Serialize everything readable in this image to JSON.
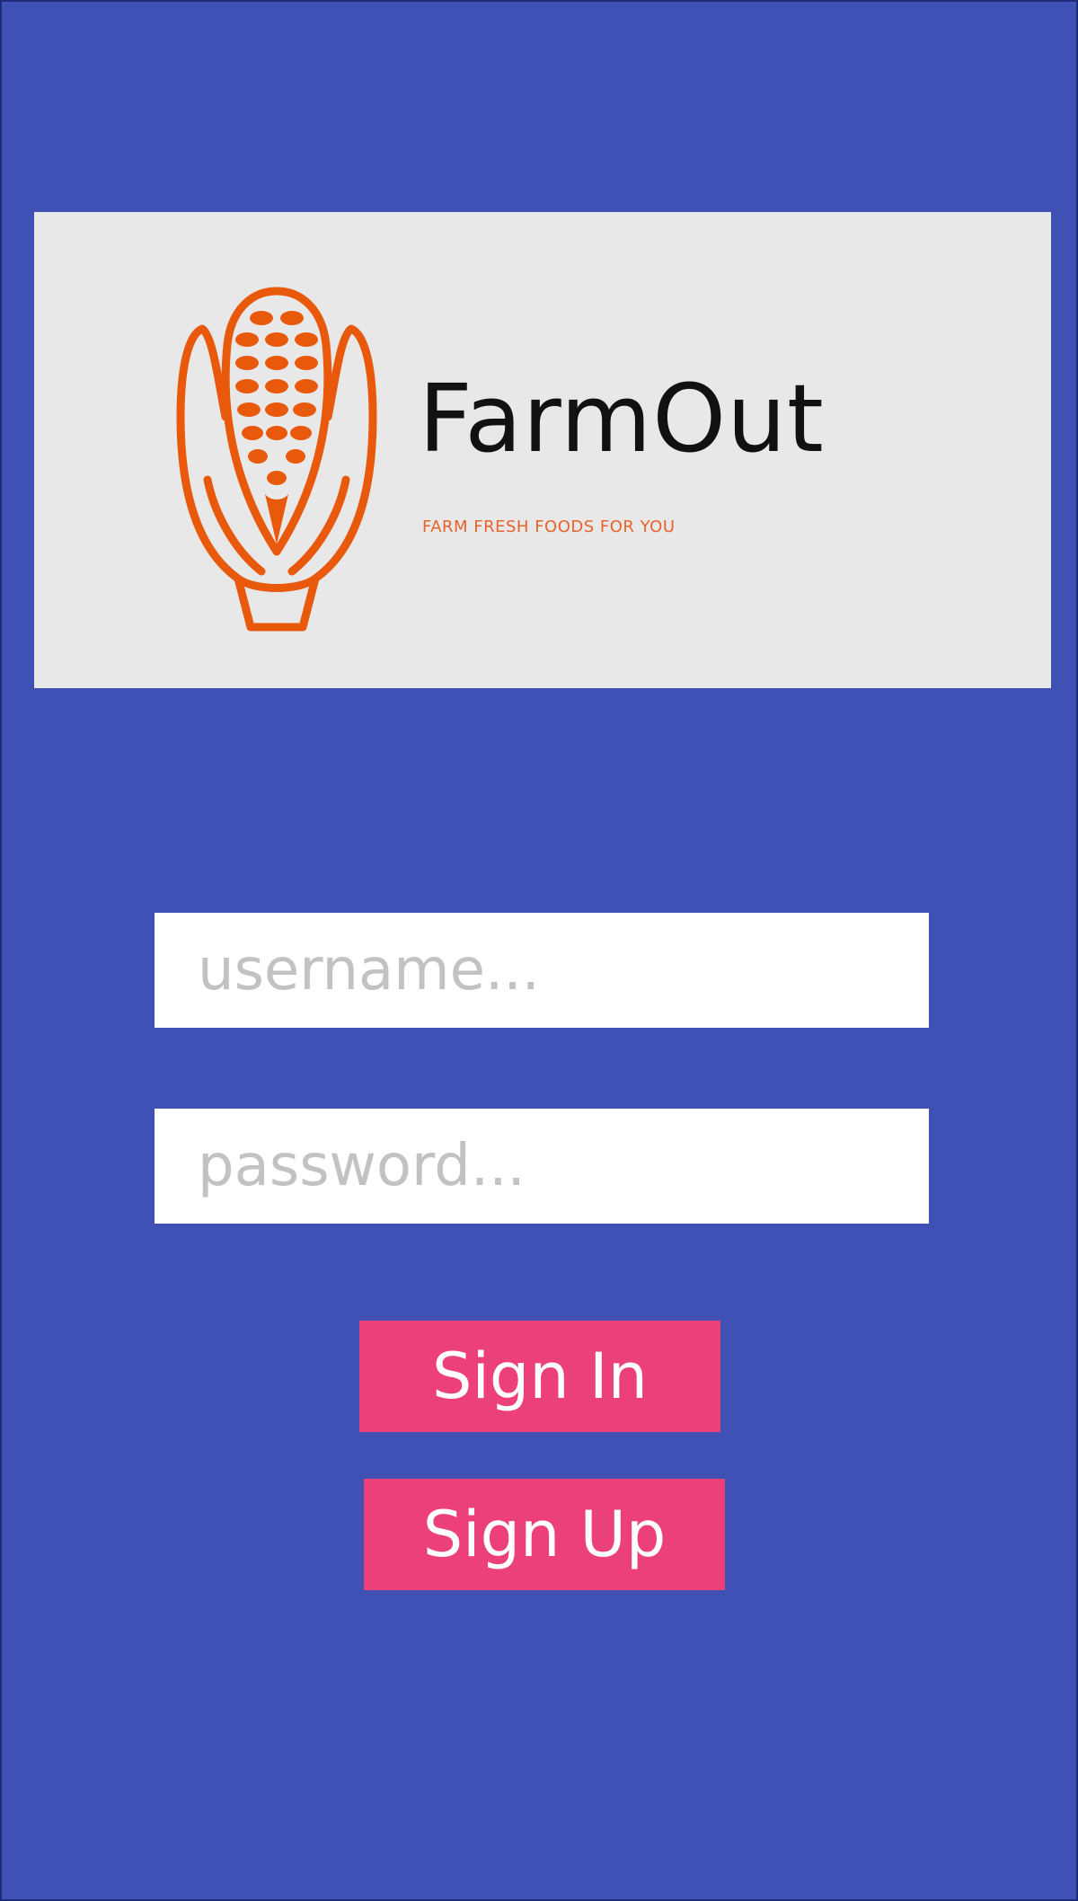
{
  "brand": {
    "name": "FarmOut",
    "tagline": "FARM FRESH FOODS FOR YOU",
    "icon": "corn-icon",
    "accent_color": "#e8590c"
  },
  "login": {
    "username_placeholder": "username...",
    "password_placeholder": "password...",
    "username_value": "",
    "password_value": ""
  },
  "actions": {
    "sign_in_label": "Sign In",
    "sign_up_label": "Sign Up"
  },
  "colors": {
    "background": "#3f51b5",
    "banner": "#e8e8e8",
    "button": "#ec407a",
    "button_text": "#ffffff"
  }
}
